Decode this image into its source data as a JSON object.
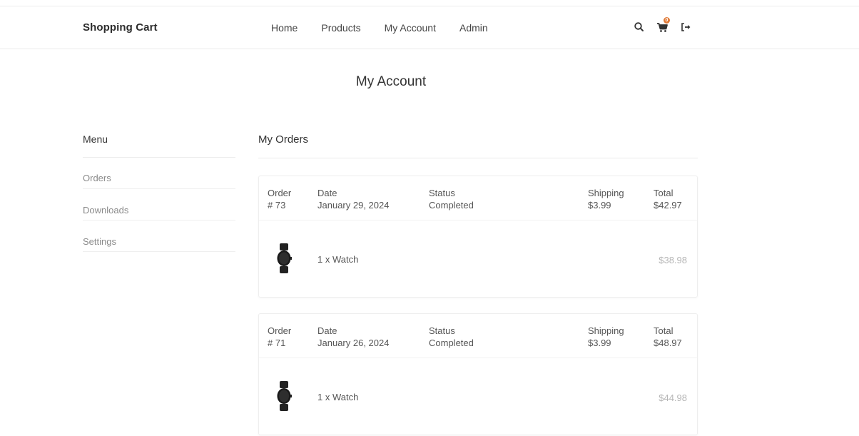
{
  "navbar": {
    "brand": "Shopping Cart",
    "links": [
      "Home",
      "Products",
      "My Account",
      "Admin"
    ],
    "icons": [
      "search-icon",
      "cart-icon",
      "logout-icon"
    ],
    "cart_count": "0",
    "badge_color": "#e07b39"
  },
  "page": {
    "title": "My Account"
  },
  "sidebar": {
    "heading": "Menu",
    "items": [
      "Orders",
      "Downloads",
      "Settings"
    ]
  },
  "orders": {
    "heading": "My Orders",
    "list": [
      {
        "order_label": "Order",
        "order_number": "# 73",
        "date_label": "Date",
        "date": "January 29, 2024",
        "status_label": "Status",
        "status": "Completed",
        "shipping_label": "Shipping",
        "shipping": "$3.99",
        "total_label": "Total",
        "total": "$42.97",
        "item": {
          "name": "1 x Watch",
          "price": "$38.98",
          "icon": "watch-icon"
        }
      },
      {
        "order_label": "Order",
        "order_number": "# 71",
        "date_label": "Date",
        "date": "January 26, 2024",
        "status_label": "Status",
        "status": "Completed",
        "shipping_label": "Shipping",
        "shipping": "$3.99",
        "total_label": "Total",
        "total": "$48.97",
        "item": {
          "name": "1 x Watch",
          "price": "$44.98",
          "icon": "watch-icon"
        }
      }
    ]
  }
}
